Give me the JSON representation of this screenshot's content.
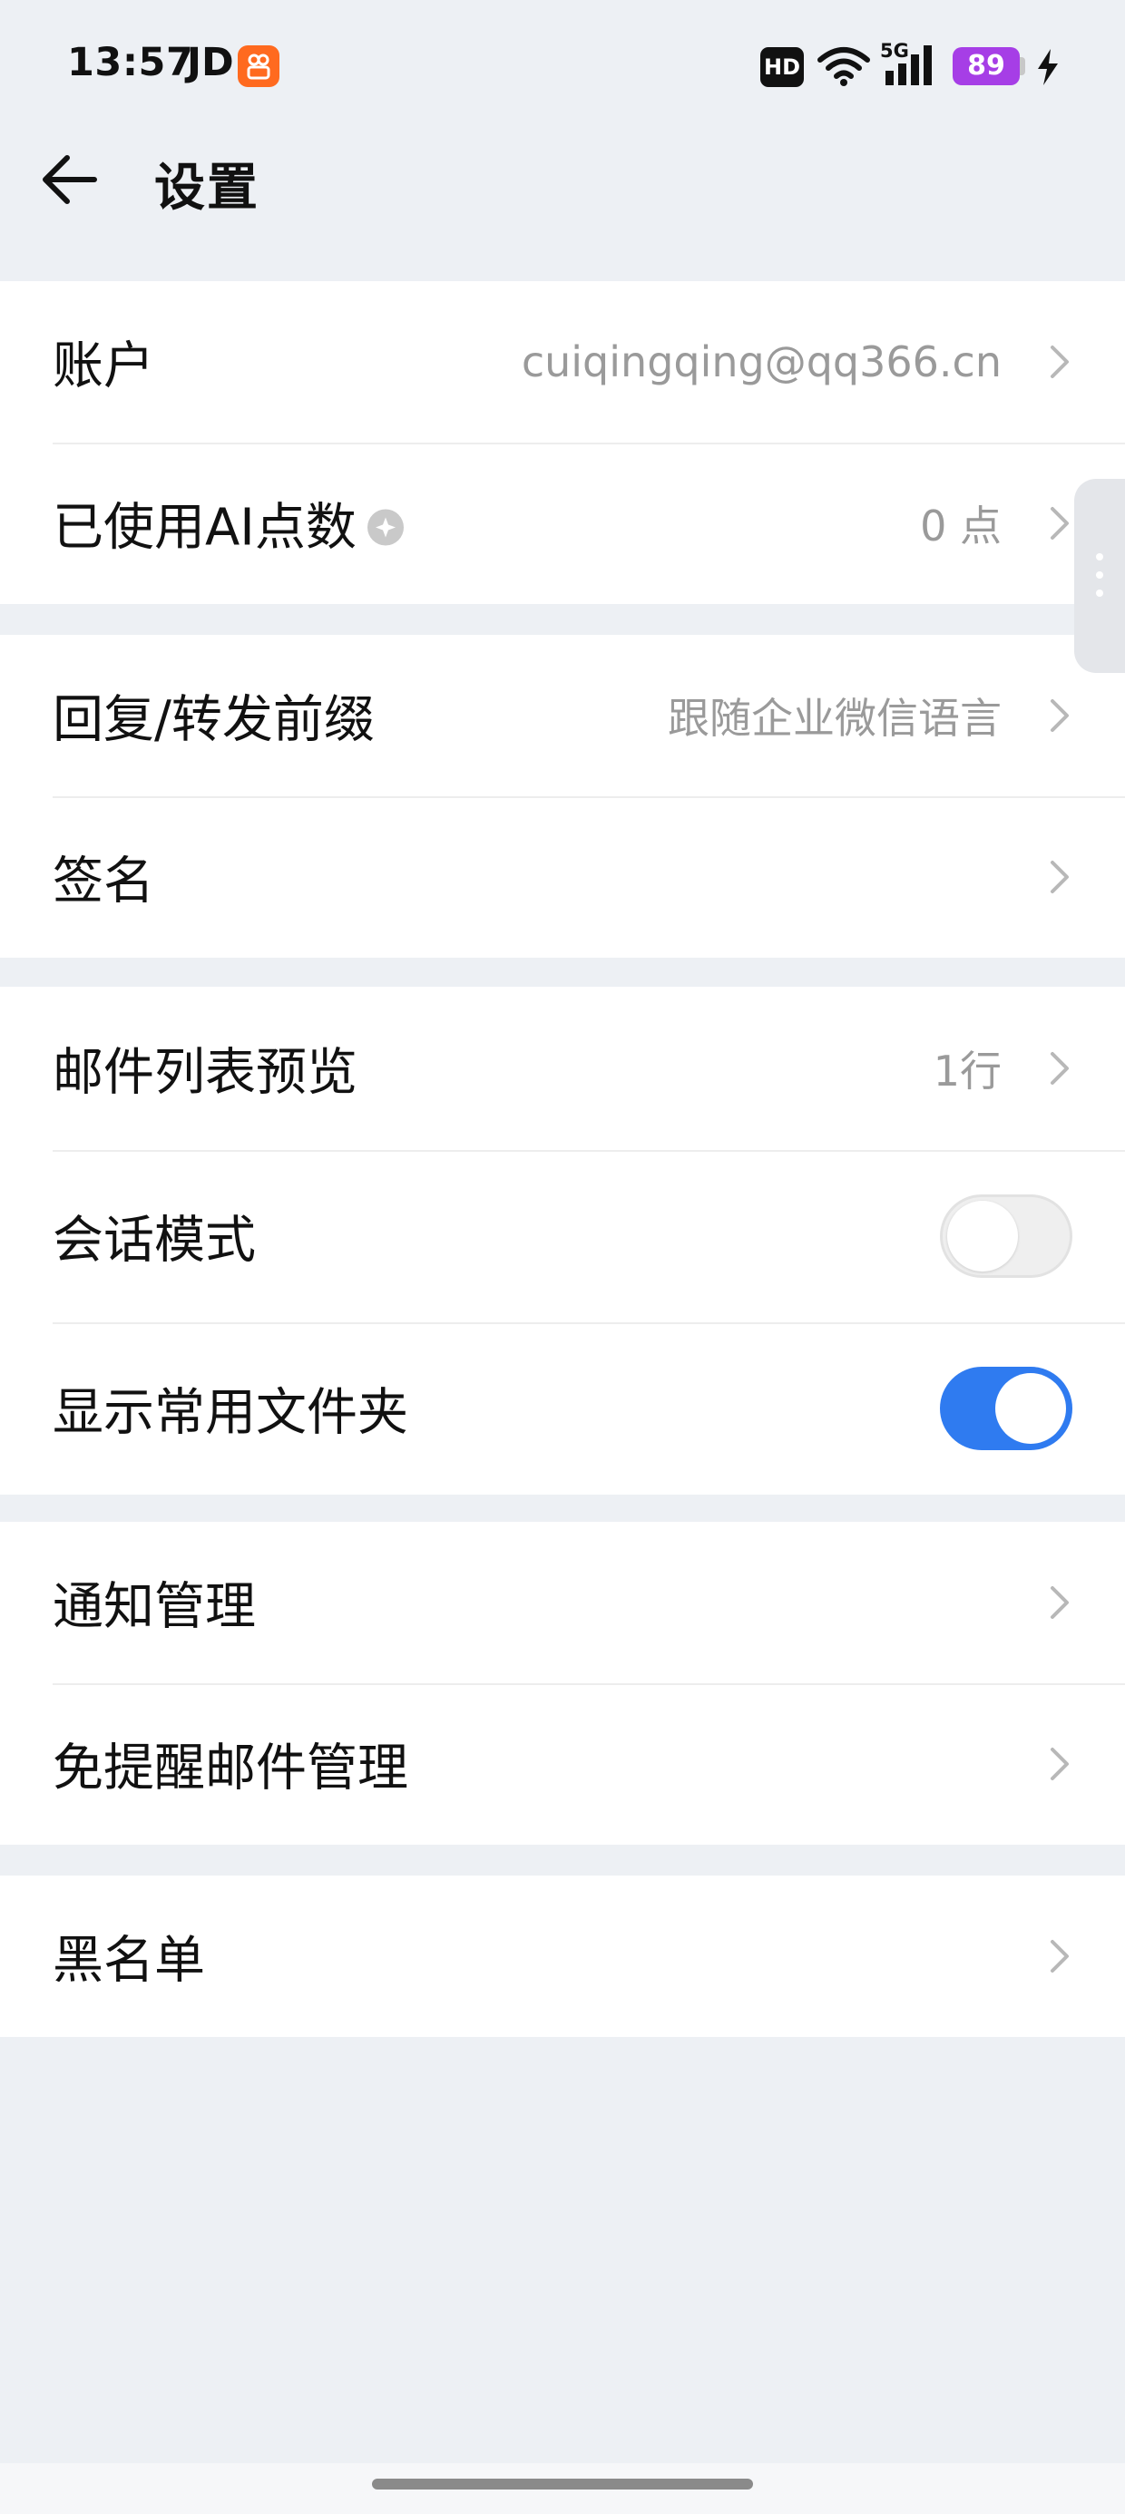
{
  "status_bar": {
    "time": "13:57",
    "carrier_app": "JD",
    "hd_label": "HD",
    "network": "5G",
    "battery": "89",
    "icons": [
      "app-badge-icon",
      "wifi-icon",
      "signal-icon",
      "charging-icon"
    ]
  },
  "header": {
    "title": "设置",
    "back_icon": "arrow-left-icon"
  },
  "groups": [
    {
      "rows": [
        {
          "label": "账户",
          "value": "cuiqingqing@qq366.cn",
          "type": "link"
        },
        {
          "label": "已使用AI点数",
          "value": "0 点",
          "type": "link",
          "has_info_icon": true
        }
      ]
    },
    {
      "rows": [
        {
          "label": "回复/转发前缀",
          "value": "跟随企业微信语言",
          "type": "link"
        },
        {
          "label": "签名",
          "value": "",
          "type": "link"
        }
      ]
    },
    {
      "rows": [
        {
          "label": "邮件列表预览",
          "value": "1行",
          "type": "link"
        },
        {
          "label": "会话模式",
          "type": "toggle",
          "on": false
        },
        {
          "label": "显示常用文件夹",
          "type": "toggle",
          "on": true
        }
      ]
    },
    {
      "rows": [
        {
          "label": "通知管理",
          "value": "",
          "type": "link"
        },
        {
          "label": "免提醒邮件管理",
          "value": "",
          "type": "link"
        }
      ]
    },
    {
      "rows": [
        {
          "label": "黑名单",
          "value": "",
          "type": "link"
        }
      ]
    }
  ],
  "colors": {
    "background": "#edf0f4",
    "toggle_on": "#2f7bf0",
    "battery": "#a63ee6",
    "app_badge": "#ff6a1f"
  }
}
